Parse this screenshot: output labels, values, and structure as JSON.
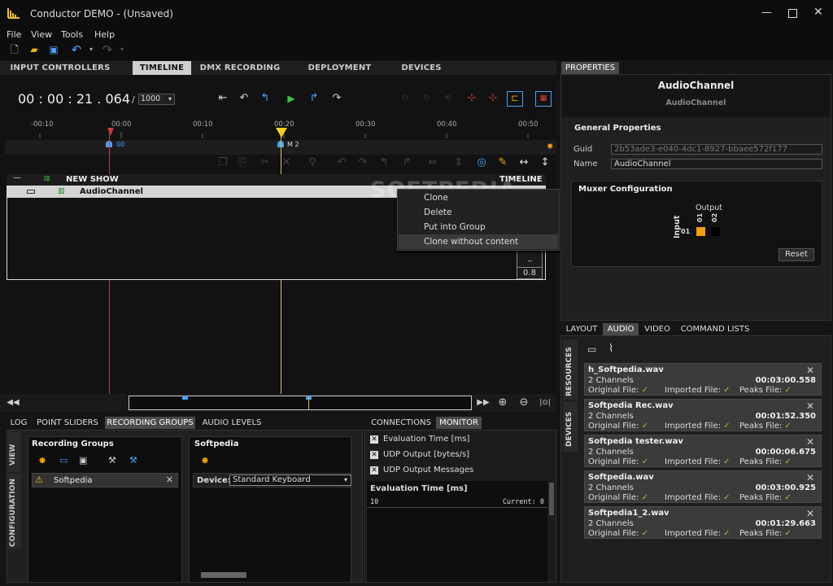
{
  "window": {
    "title": "Conductor DEMO - (Unsaved)"
  },
  "menu": [
    "File",
    "View",
    "Tools",
    "Help"
  ],
  "main_tabs": [
    "INPUT CONTROLLERS",
    "TIMELINE",
    "DMX RECORDING",
    "DEPLOYMENT",
    "DEVICES"
  ],
  "timeline": {
    "time": "00 : 00 : 21 . 064",
    "divider": "/",
    "zoom": "1000",
    "ticks": [
      "-00:10",
      "00:00",
      "00:10",
      "00:20",
      "00:30",
      "00:40",
      "00:50"
    ],
    "marker_labels": [
      "00",
      "M 2"
    ],
    "show_name": "NEW SHOW",
    "timeline_label": "TIMELINE",
    "channel_name": "AudioChannel",
    "volume_value": "0.8",
    "playhead_time": "00:20"
  },
  "context_menu": [
    "Clone",
    "Delete",
    "Put into Group",
    "Clone without content"
  ],
  "watermark": "SOFTPEDIA",
  "properties": {
    "tab": "PROPERTIES",
    "title": "AudioChannel",
    "subtitle": "AudioChannel",
    "general_title": "General Properties",
    "guid_label": "Guid",
    "guid_value": "2b53ade3-e040-4dc1-8927-bbaee572f177",
    "name_label": "Name",
    "name_value": "AudioChannel",
    "muxer_title": "Muxer Configuration",
    "output_label": "Output",
    "output_cols": [
      "01",
      "02"
    ],
    "input_label": "Input",
    "input_rows": [
      "01"
    ],
    "reset_label": "Reset",
    "accent": "#f2a10c"
  },
  "resources": {
    "tabs": [
      "LAYOUT",
      "AUDIO",
      "VIDEO",
      "COMMAND LISTS"
    ],
    "side_tabs": [
      "RESOURCES",
      "DEVICES"
    ],
    "items": [
      {
        "name": "h_Softpedia.wav",
        "channels": "2 Channels",
        "duration": "00:03:00.558",
        "original": "Original File: ✓",
        "imported": "Imported File: ✓",
        "peaks": "Peaks File: ✓"
      },
      {
        "name": "Softpedia Rec.wav",
        "channels": "2 Channels",
        "duration": "00:01:52.350",
        "original": "Original File: ✓",
        "imported": "Imported File: ✓",
        "peaks": "Peaks File: ✓"
      },
      {
        "name": "Softpedia tester.wav",
        "channels": "2 Channels",
        "duration": "00:00:06.675",
        "original": "Original File: ✓",
        "imported": "Imported File: ✓",
        "peaks": "Peaks File: ✓"
      },
      {
        "name": "Softpedia.wav",
        "channels": "2 Channels",
        "duration": "00:03:00.925",
        "original": "Original File: ✓",
        "imported": "Imported File: ✓",
        "peaks": "Peaks File: ✓"
      },
      {
        "name": "Softpedia1_2.wav",
        "channels": "2 Channels",
        "duration": "00:01:29.663",
        "original": "Original File: ✓",
        "imported": "Imported File: ✓",
        "peaks": "Peaks File: ✓"
      }
    ]
  },
  "bottom": {
    "tabs": [
      "LOG",
      "POINT SLIDERS",
      "RECORDING GROUPS",
      "AUDIO LEVELS"
    ],
    "side_tabs": [
      "VIEW",
      "CONFIGURATION"
    ],
    "groups_title": "Recording Groups",
    "group_item": "Softpedia",
    "detail_title": "Softpedia",
    "device_label": "Device:",
    "device_value": "Standard Keyboard"
  },
  "monitor": {
    "tabs": [
      "CONNECTIONS",
      "MONITOR"
    ],
    "checks": [
      "Evaluation Time [ms]",
      "UDP Output [bytes/s]",
      "UDP Output Messages"
    ],
    "graph_title": "Evaluation Time [ms]",
    "graph_value": "10",
    "graph_current": "Current: 0"
  }
}
